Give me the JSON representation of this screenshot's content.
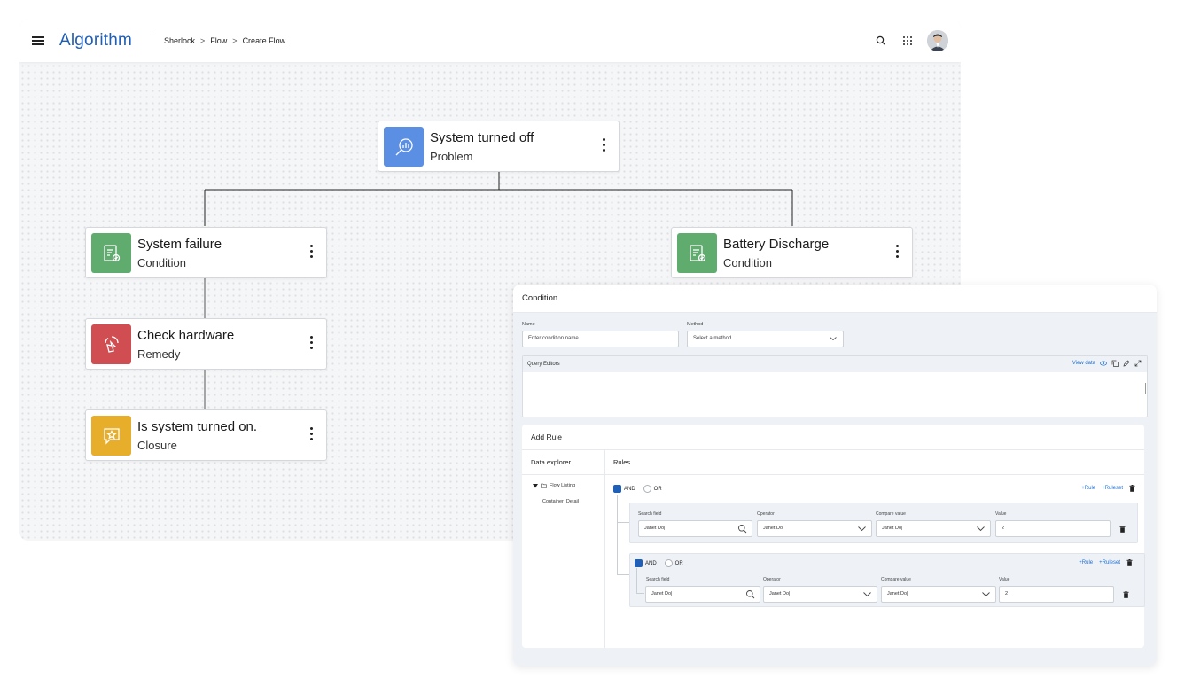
{
  "app": {
    "brand": "Algorithm",
    "breadcrumb": [
      "Sherlock",
      "Flow",
      "Create Flow"
    ],
    "breadcrumb_separator": ">"
  },
  "header_icons": [
    "search-icon",
    "apps-grid-icon",
    "user-avatar"
  ],
  "flow": {
    "nodes": [
      {
        "id": "problem",
        "title": "System turned off",
        "type": "Problem",
        "icon": "search-analytics-icon",
        "color": "#5b8fe3"
      },
      {
        "id": "cond1",
        "title": "System failure",
        "type": "Condition",
        "icon": "clipboard-check-icon",
        "color": "#5fac6e"
      },
      {
        "id": "cond2",
        "title": "Battery Discharge",
        "type": "Condition",
        "icon": "clipboard-check-icon",
        "color": "#5fac6e"
      },
      {
        "id": "remedy",
        "title": "Check hardware",
        "type": "Remedy",
        "icon": "hand-pointer-icon",
        "color": "#d04e52"
      },
      {
        "id": "closure",
        "title": "Is system turned on.",
        "type": "Closure",
        "icon": "chat-star-icon",
        "color": "#e6ae2b"
      }
    ]
  },
  "condition_panel": {
    "title": "Condition",
    "name_label": "Name",
    "name_placeholder": "Enter condition name",
    "method_label": "Method",
    "method_placeholder": "Select a method",
    "query_editors_label": "Query Editors",
    "view_data_label": "View data",
    "add_rule_title": "Add Rule",
    "data_explorer_label": "Data explorer",
    "rules_label": "Rules",
    "tree": {
      "root": "Flow Listing",
      "child": "Container_Detail"
    },
    "group1": {
      "and_label": "AND",
      "or_label": "OR",
      "add_rule": "+Rule",
      "add_ruleset": "+Ruleset",
      "rule": {
        "search_field_label": "Search field",
        "search_field_value": "Janet Do|",
        "operator_label": "Operator",
        "operator_value": "Janet Do|",
        "compare_label": "Compare value",
        "compare_value": "Janet Do|",
        "value_label": "Value",
        "value": "2"
      }
    },
    "group2": {
      "and_label": "AND",
      "or_label": "OR",
      "add_rule": "+Rule",
      "add_ruleset": "+Ruleset",
      "rule": {
        "search_field_label": "Search field",
        "search_field_value": "Janet Do|",
        "operator_label": "Operator",
        "operator_value": "Janet Do|",
        "compare_label": "Compare value",
        "compare_value": "Janet Do|",
        "value_label": "Value",
        "value": "2"
      }
    }
  }
}
